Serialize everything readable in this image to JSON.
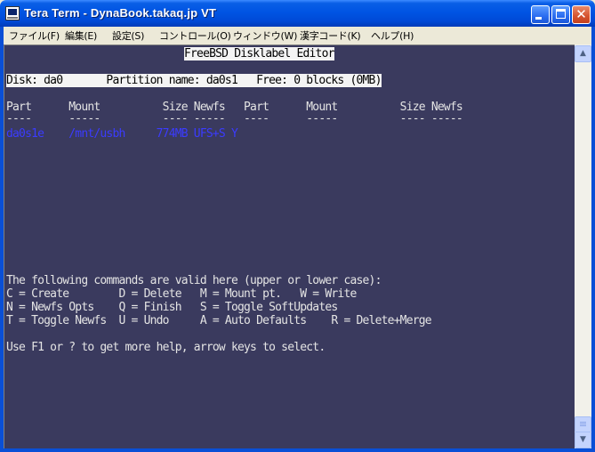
{
  "window": {
    "title": "Tera Term - DynaBook.takaq.jp VT"
  },
  "menubar": {
    "items": [
      {
        "label": "ファイル(F)"
      },
      {
        "label": "編集(E)"
      },
      {
        "label": "設定(S)"
      },
      {
        "label": "コントロール(O)"
      },
      {
        "label": "ウィンドウ(W)"
      },
      {
        "label": "漢字コード(K)"
      },
      {
        "label": "ヘルプ(H)"
      }
    ]
  },
  "terminal": {
    "header": "FreeBSD Disklabel Editor",
    "disk_line": "Disk: da0       Partition name: da0s1   Free: 0 blocks (0MB)",
    "columns_line": "Part      Mount          Size Newfs   Part      Mount          Size Newfs",
    "dashes_line": "----      -----          ---- -----   ----      -----          ---- -----",
    "partition_row": "da0s1e    /mnt/usbh     774MB UFS+S Y",
    "cmd_intro": "The following commands are valid here (upper or lower case):",
    "cmd_line1": "C = Create        D = Delete   M = Mount pt.   W = Write",
    "cmd_line2": "N = Newfs Opts    Q = Finish   S = Toggle SoftUpdates",
    "cmd_line3": "T = Toggle Newfs  U = Undo     A = Auto Defaults    R = Delete+Merge",
    "help_line": "Use F1 or ? to get more help, arrow keys to select."
  },
  "colors": {
    "terminal_bg": "#3a3a5e",
    "terminal_fg": "#e4e4e4",
    "highlight_fg": "#3b3bff",
    "titlebar": "#0054e3"
  },
  "icons": {
    "app": "tera-term-icon",
    "minimize": "minimize-icon",
    "maximize": "maximize-icon",
    "close": "close-icon"
  }
}
